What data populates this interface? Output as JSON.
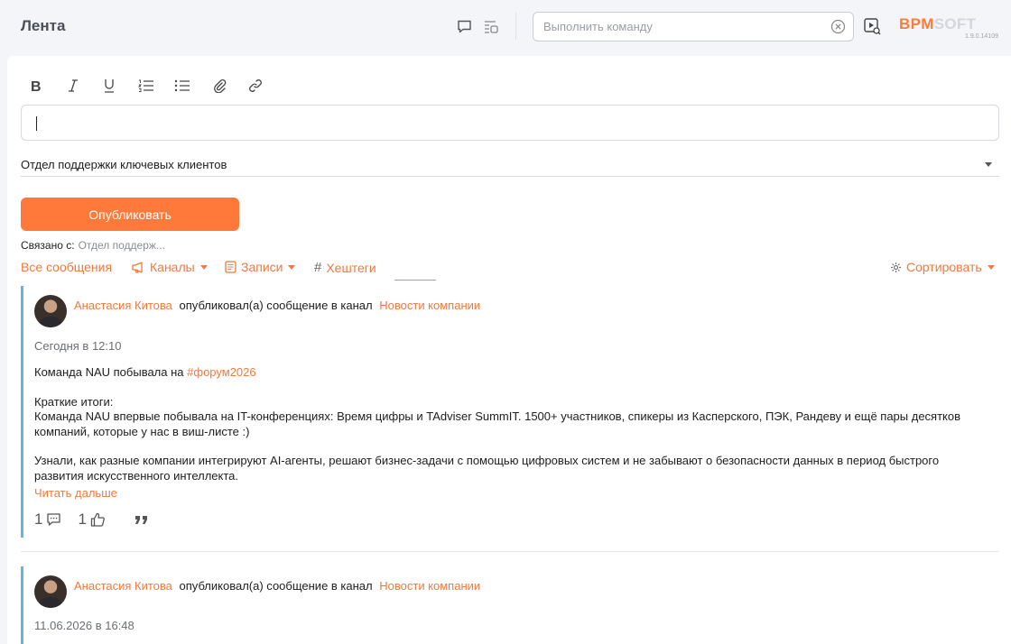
{
  "header": {
    "title": "Лента",
    "command_placeholder": "Выполнить команду",
    "logo_primary": "BPM",
    "logo_secondary": "SOFT",
    "version": "1.9.0.14109"
  },
  "editor": {
    "toolbar": [
      "bold-icon",
      "italic-icon",
      "underline-icon",
      "numbered-list-icon",
      "bulleted-list-icon",
      "attach-icon",
      "link-icon"
    ],
    "channel_value": "Отдел поддержки ключевых клиентов",
    "publish_label": "Опубликовать",
    "related_label": "Связано с:",
    "related_value": "Отдел поддерж..."
  },
  "filters": {
    "all": "Все сообщения",
    "channels": "Каналы",
    "posts": "Записи",
    "hashtags": "Хештеги",
    "sort": "Сортировать"
  },
  "posts": [
    {
      "author": "Анастасия Китова",
      "action": "опубликовал(а) сообщение в канал",
      "channel": "Новости компании",
      "date": "Сегодня в 12:10",
      "title_text": "Команда NAU побывала на",
      "hashtag": "#форум2026",
      "summary_label": "Краткие итоги:",
      "para1": "Команда NAU впервые побывала на IT-конференциях: Время цифры и TAdviser SummIT. 1500+ участников, спикеры из Касперского, ПЭК, Рандеву и ещё пары десятков компаний, которые у нас в виш-листе :)",
      "para2": "Узнали, как разные компании интегрируют AI-агенты, решают бизнес-задачи с помощью цифровых систем и не забывают о безопасности данных в период быстрого развития искусственного интеллекта.",
      "read_more": "Читать дальше",
      "comments": "1",
      "likes": "1"
    },
    {
      "author": "Анастасия Китова",
      "action": "опубликовал(а) сообщение в канал",
      "channel": "Новости компании",
      "date": "11.06.2026 в 16:48"
    }
  ],
  "colors": {
    "accent": "#ff7a3a",
    "post_border": "#63b3e6"
  }
}
